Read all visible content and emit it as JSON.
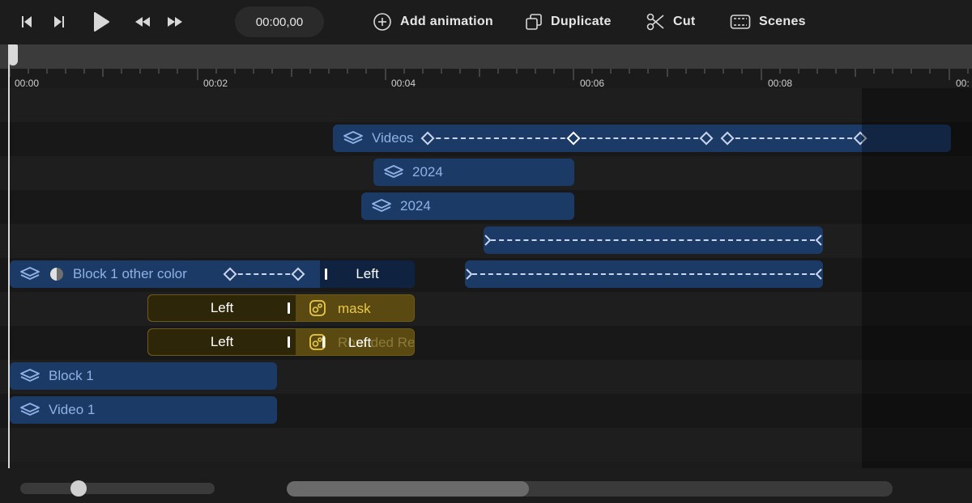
{
  "toolbar": {
    "timecode": "00:00,00",
    "add_animation": "Add animation",
    "duplicate": "Duplicate",
    "cut": "Cut",
    "scenes": "Scenes"
  },
  "ruler": {
    "labels": [
      "00:00",
      "00:02",
      "00:04",
      "00:06",
      "00:08",
      "00:"
    ]
  },
  "tracks": {
    "videos_label": "Videos",
    "year1": "2024",
    "year2": "2024",
    "block1_other": "Block 1 other color",
    "left_a": "Left",
    "left_b": "Left",
    "mask": "mask",
    "left_c": "Left",
    "rounded": "Rounded Re",
    "left_d": "Left",
    "block1": "Block 1",
    "video1": "Video 1"
  },
  "colors": {
    "clip_blue": "#1c3a66",
    "clip_blue_text": "#8fb1e6",
    "clip_gold": "#5a4a12",
    "gold_text": "#e8c84a"
  },
  "zoom": {
    "level": 0.28
  },
  "scroll": {
    "position": 0.0,
    "visible": 0.4
  }
}
